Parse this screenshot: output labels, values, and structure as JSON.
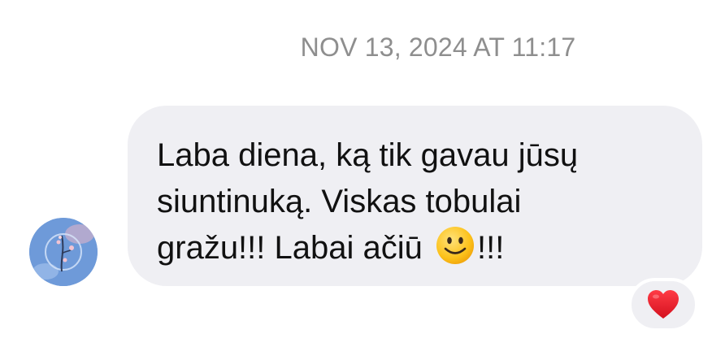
{
  "conversation": {
    "timestamp": "NOV 13, 2024 AT 11:17"
  },
  "message": {
    "text_main": "Laba diena, ką tik gavau jūsų\nsiuntinuką. Viskas tobulai\ngražu!!! Labai ačiū ",
    "text_tail": "!!!",
    "emoji": "smiling-face-icon",
    "bubble_color": "#efeff3"
  },
  "sender": {
    "avatar": "profile-avatar"
  },
  "reaction": {
    "icon": "red-heart-icon",
    "color": "#e8192c"
  }
}
